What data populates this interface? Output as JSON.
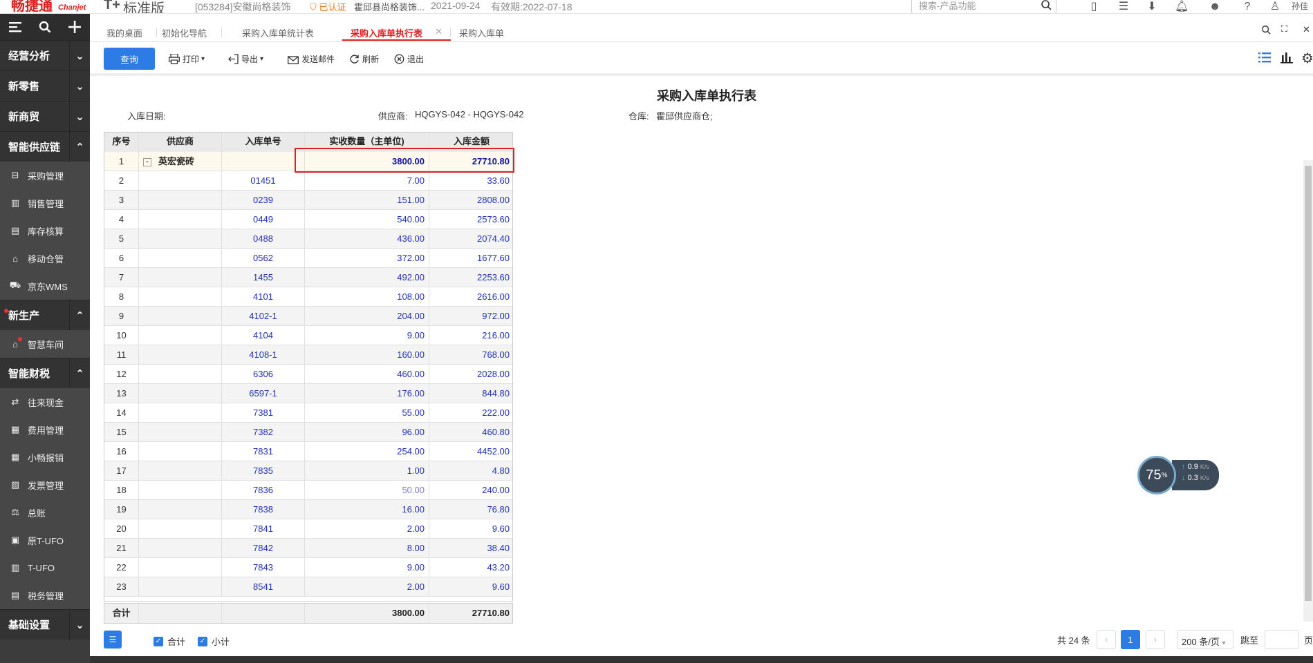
{
  "header": {
    "logo_text": "畅捷通",
    "logo_sub": "Chanjet",
    "edition": "标准版",
    "edition_mark": "T+",
    "company": "[053284]安徽尚格装饰",
    "cert_label": "已认证",
    "cert_company": "霍邱县尚格装饰...",
    "date": "2021-09-24",
    "expiry": "有效期:2022-07-18",
    "search_placeholder": "搜索-产品功能",
    "user": "孙佳"
  },
  "sidebar": {
    "groups": [
      {
        "label": "经营分析"
      },
      {
        "label": "新零售"
      },
      {
        "label": "新商贸"
      },
      {
        "label": "智能供应链"
      },
      {
        "label": "新生产"
      },
      {
        "label": "智能财税"
      },
      {
        "label": "基础设置"
      }
    ],
    "supply_items": [
      {
        "label": "采购管理",
        "icon": "purchase-icon"
      },
      {
        "label": "销售管理",
        "icon": "sales-icon"
      },
      {
        "label": "库存核算",
        "icon": "inventory-icon"
      },
      {
        "label": "移动仓管",
        "icon": "mobile-warehouse-icon"
      },
      {
        "label": "京东WMS",
        "icon": "truck-icon"
      }
    ],
    "production_items": [
      {
        "label": "智慧车间",
        "icon": "workshop-icon"
      }
    ],
    "finance_items": [
      {
        "label": "往来现金",
        "icon": "transfer-icon"
      },
      {
        "label": "费用管理",
        "icon": "expense-icon"
      },
      {
        "label": "小畅报销",
        "icon": "reimburse-icon"
      },
      {
        "label": "发票管理",
        "icon": "invoice-icon"
      },
      {
        "label": "总账",
        "icon": "ledger-icon"
      },
      {
        "label": "原T-UFO",
        "icon": "ufo-icon"
      },
      {
        "label": "T-UFO",
        "icon": "building-icon"
      },
      {
        "label": "税务管理",
        "icon": "tax-icon"
      }
    ]
  },
  "tabs": [
    {
      "label": "我的桌面"
    },
    {
      "label": "初始化导航"
    },
    {
      "label": "采购入库单统计表"
    },
    {
      "label": "采购入库单执行表"
    },
    {
      "label": "采购入库单"
    }
  ],
  "toolbar": {
    "query": "查询",
    "print": "打印",
    "export": "导出",
    "email": "发送邮件",
    "refresh": "刷新",
    "exit": "退出"
  },
  "report": {
    "title": "采购入库单执行表",
    "filter_date_label": "入库日期:",
    "filter_supplier_label": "供应商:",
    "filter_supplier_value": "HQGYS-042 - HQGYS-042",
    "filter_warehouse_label": "仓库:",
    "filter_warehouse_value": "霍邱供应商仓;",
    "columns": [
      "序号",
      "供应商",
      "入库单号",
      "实收数量（主单位)",
      "入库金额"
    ],
    "group_row": {
      "seq": "1",
      "supplier": "英宏瓷砖",
      "qty": "3800.00",
      "amount": "27710.80"
    },
    "rows": [
      {
        "seq": "2",
        "order": "01451",
        "qty": "7.00",
        "amount": "33.60"
      },
      {
        "seq": "3",
        "order": "0239",
        "qty": "151.00",
        "amount": "2808.00"
      },
      {
        "seq": "4",
        "order": "0449",
        "qty": "540.00",
        "amount": "2573.60"
      },
      {
        "seq": "5",
        "order": "0488",
        "qty": "436.00",
        "amount": "2074.40"
      },
      {
        "seq": "6",
        "order": "0562",
        "qty": "372.00",
        "amount": "1677.60"
      },
      {
        "seq": "7",
        "order": "1455",
        "qty": "492.00",
        "amount": "2253.60"
      },
      {
        "seq": "8",
        "order": "4101",
        "qty": "108.00",
        "amount": "2616.00"
      },
      {
        "seq": "9",
        "order": "4102-1",
        "qty": "204.00",
        "amount": "972.00"
      },
      {
        "seq": "10",
        "order": "4104",
        "qty": "9.00",
        "amount": "216.00"
      },
      {
        "seq": "11",
        "order": "4108-1",
        "qty": "160.00",
        "amount": "768.00"
      },
      {
        "seq": "12",
        "order": "6306",
        "qty": "460.00",
        "amount": "2028.00"
      },
      {
        "seq": "13",
        "order": "6597-1",
        "qty": "176.00",
        "amount": "844.80"
      },
      {
        "seq": "14",
        "order": "7381",
        "qty": "55.00",
        "amount": "222.00"
      },
      {
        "seq": "15",
        "order": "7382",
        "qty": "96.00",
        "amount": "460.80"
      },
      {
        "seq": "16",
        "order": "7831",
        "qty": "254.00",
        "amount": "4452.00"
      },
      {
        "seq": "17",
        "order": "7835",
        "qty": "1.00",
        "amount": "4.80"
      },
      {
        "seq": "18",
        "order": "7836",
        "qty": "50.00",
        "amount": "240.00"
      },
      {
        "seq": "19",
        "order": "7838",
        "qty": "16.00",
        "amount": "76.80"
      },
      {
        "seq": "20",
        "order": "7841",
        "qty": "2.00",
        "amount": "9.60"
      },
      {
        "seq": "21",
        "order": "7842",
        "qty": "8.00",
        "amount": "38.40"
      },
      {
        "seq": "22",
        "order": "7843",
        "qty": "9.00",
        "amount": "43.20"
      },
      {
        "seq": "23",
        "order": "8541",
        "qty": "2.00",
        "amount": "9.60"
      }
    ],
    "total": {
      "label": "合计",
      "qty": "3800.00",
      "amount": "27710.80"
    }
  },
  "footer": {
    "sum_label": "合计",
    "subtotal_label": "小计",
    "total_count": "共 24 条",
    "current_page": "1",
    "page_size": "200 条/页",
    "jump_label": "跳至",
    "page_suffix": "页"
  },
  "speed_widget": {
    "percent": "75",
    "percent_unit": "%",
    "up": "0.9",
    "down": "0.3",
    "unit": "K/s"
  },
  "colors": {
    "accent": "#2d7be5",
    "brand_red": "#e02020",
    "sidebar": "#3c3c3c"
  }
}
